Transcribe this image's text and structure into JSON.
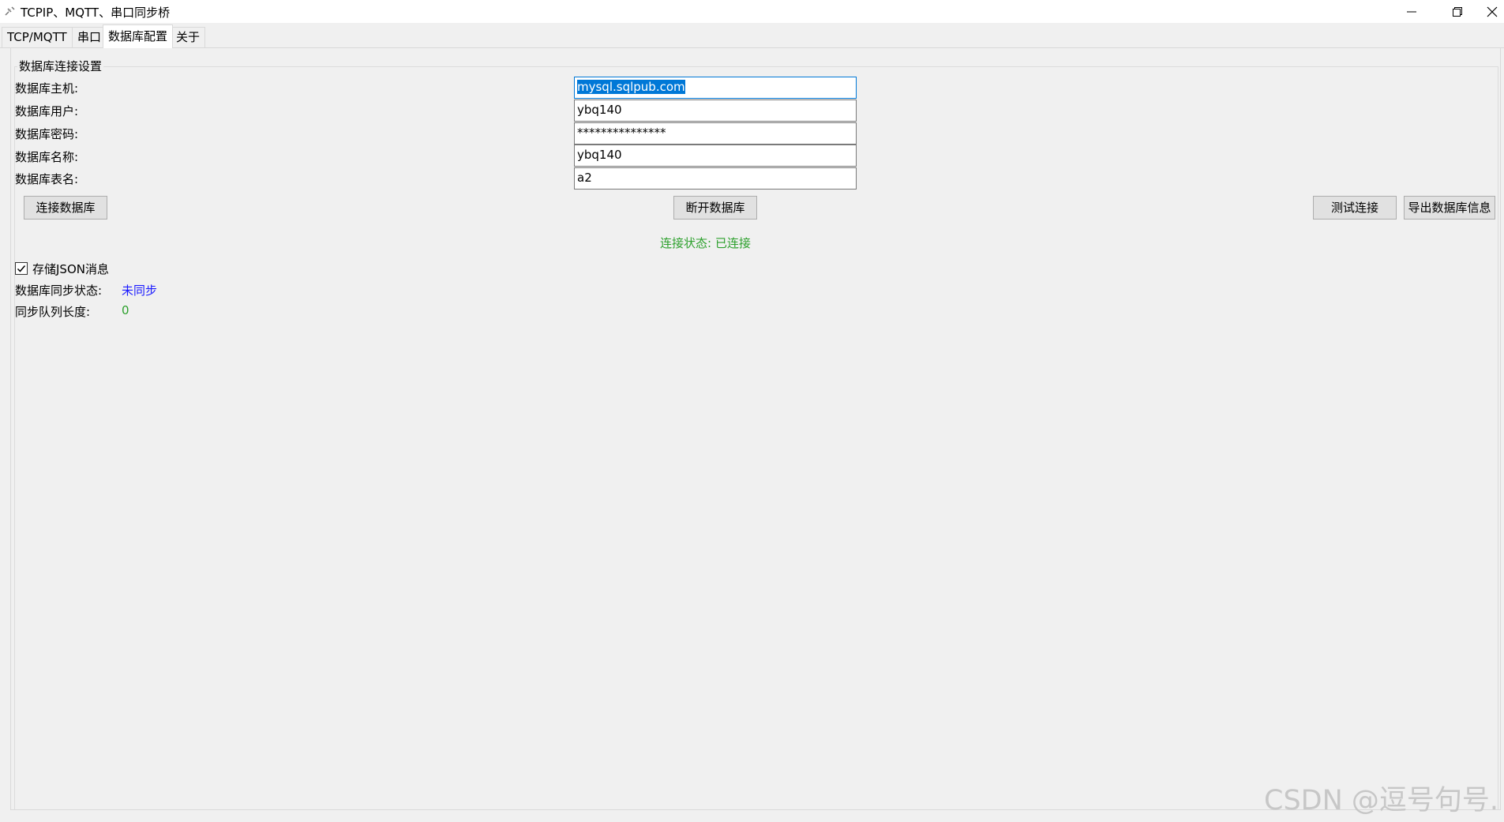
{
  "window": {
    "title": "TCPIP、MQTT、串口同步桥",
    "app_icon": "app-logo-icon",
    "minimize_icon": "minimize-icon",
    "maximize_icon": "restore-icon",
    "close_icon": "close-icon"
  },
  "tabs": [
    {
      "label": "TCP/MQTT",
      "active": false
    },
    {
      "label": "串口",
      "active": false
    },
    {
      "label": "数据库配置",
      "active": true
    },
    {
      "label": "关于",
      "active": false
    }
  ],
  "db_settings": {
    "group_title": "数据库连接设置",
    "fields": [
      {
        "label": "数据库主机:",
        "value": "mysql.sqlpub.com",
        "selected": true
      },
      {
        "label": "数据库用户:",
        "value": "ybq140"
      },
      {
        "label": "数据库密码:",
        "value": "***************"
      },
      {
        "label": "数据库名称:",
        "value": "ybq140"
      },
      {
        "label": "数据库表名:",
        "value": "a2"
      }
    ],
    "buttons": {
      "connect": "连接数据库",
      "disconnect": "断开数据库",
      "test": "测试连接",
      "export": "导出数据库信息"
    },
    "connection_status": "连接状态: 已连接"
  },
  "options": {
    "store_json_label": "存储JSON消息",
    "store_json_checked": true
  },
  "sync": {
    "status_label": "数据库同步状态:",
    "status_value": "未同步",
    "queue_label": "同步队列长度:",
    "queue_value": "0"
  },
  "colors": {
    "status_green": "#2ca02c",
    "sync_blue": "#1a1aff",
    "accent": "#0078d7"
  },
  "watermark": "CSDN @逗号句号."
}
